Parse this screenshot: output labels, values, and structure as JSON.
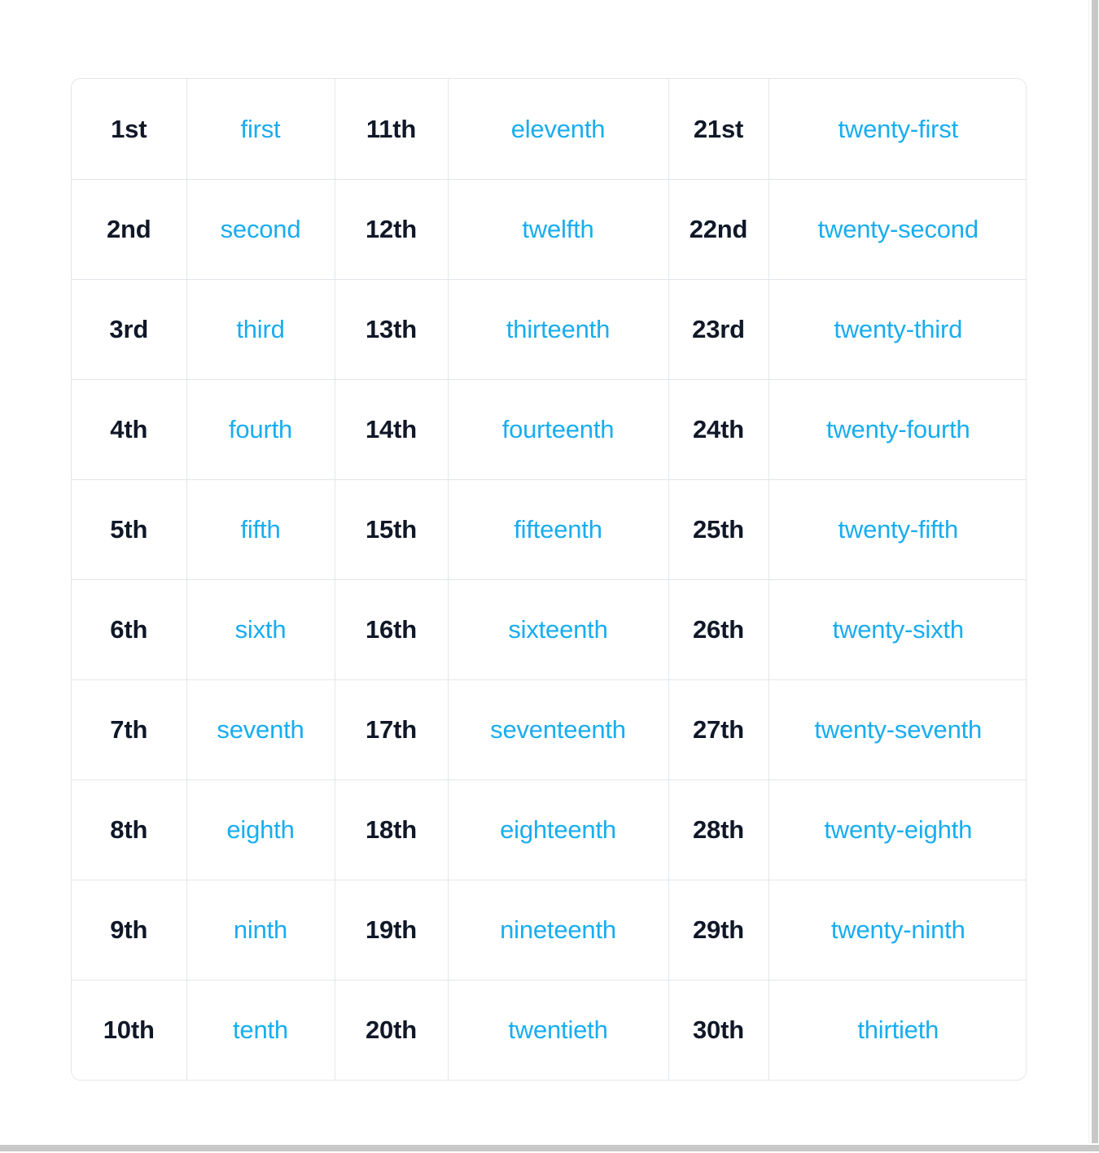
{
  "page": {
    "background_color": "#ffffff",
    "content_type": "ordinal-numbers-reference-table"
  },
  "table": {
    "border_color": "#e2e6ea",
    "number_color": "#101828",
    "word_color": "#18ADF0",
    "rows": 10,
    "columns": 6,
    "column_kinds": [
      "number",
      "word",
      "number",
      "word",
      "number",
      "word"
    ],
    "data": [
      [
        "1st",
        "first",
        "11th",
        "eleventh",
        "21st",
        "twenty-first"
      ],
      [
        "2nd",
        "second",
        "12th",
        "twelfth",
        "22nd",
        "twenty-second"
      ],
      [
        "3rd",
        "third",
        "13th",
        "thirteenth",
        "23rd",
        "twenty-third"
      ],
      [
        "4th",
        "fourth",
        "14th",
        "fourteenth",
        "24th",
        "twenty-fourth"
      ],
      [
        "5th",
        "fifth",
        "15th",
        "fifteenth",
        "25th",
        "twenty-fifth"
      ],
      [
        "6th",
        "sixth",
        "16th",
        "sixteenth",
        "26th",
        "twenty-sixth"
      ],
      [
        "7th",
        "seventh",
        "17th",
        "seventeenth",
        "27th",
        "twenty-seventh"
      ],
      [
        "8th",
        "eighth",
        "18th",
        "eighteenth",
        "28th",
        "twenty-eighth"
      ],
      [
        "9th",
        "ninth",
        "19th",
        "nineteenth",
        "29th",
        "twenty-ninth"
      ],
      [
        "10th",
        "tenth",
        "20th",
        "twentieth",
        "30th",
        "thirtieth"
      ]
    ]
  },
  "scrollbars": {
    "track_color": "#ffffff",
    "thumb_color": "#c8c8c8"
  }
}
